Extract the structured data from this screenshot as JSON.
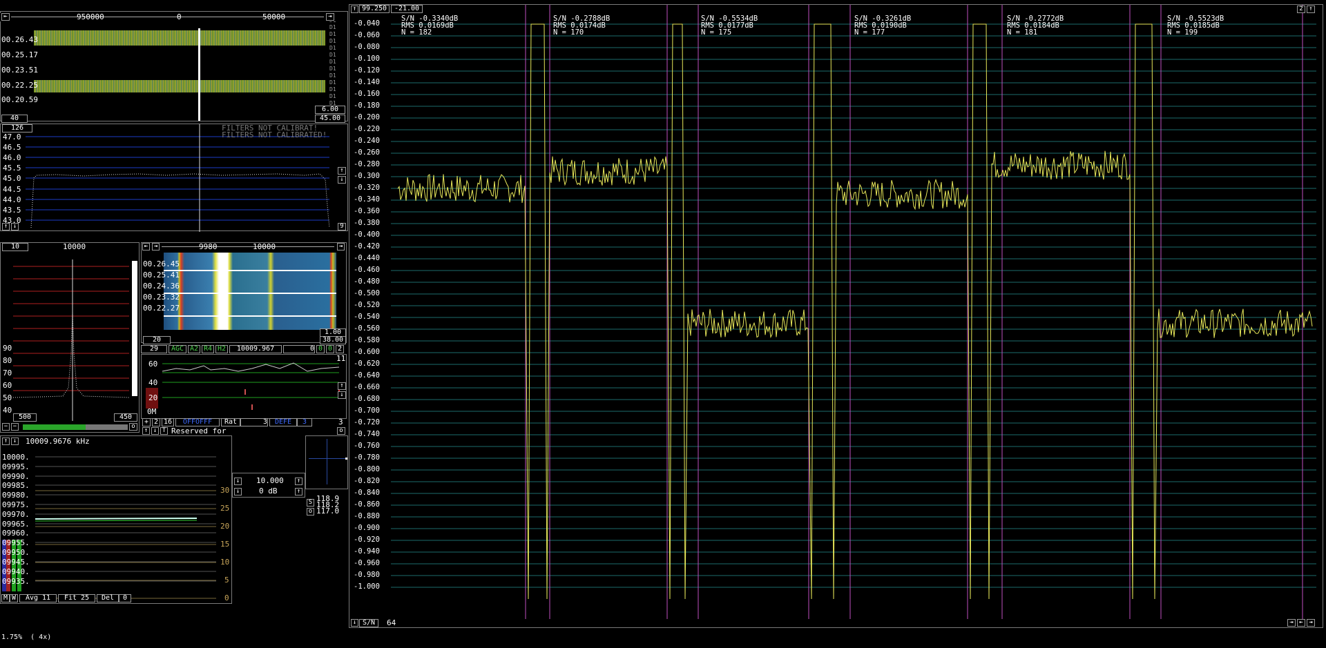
{
  "waterfall": {
    "freq_ticks": [
      "950000",
      "0",
      "50000"
    ],
    "times": [
      "00.26.43",
      "00.25.17",
      "00.23.51",
      "00.22.25",
      "00.20.59"
    ],
    "right_label": "D1",
    "left_box": "40",
    "right_box_top": "6.00",
    "right_box_bottom": "45.00"
  },
  "spectrum": {
    "top_box": "126",
    "warning_1": "FILTERS NOT CALIBRAT!",
    "warning_2": "FILTERS NOT CALIBRATED!",
    "y_labels": [
      "47.0",
      "46.5",
      "46.0",
      "45.5",
      "45.0",
      "44.5",
      "44.0",
      "43.5",
      "43.0"
    ],
    "right_btn": "9"
  },
  "baseband": {
    "left_box": "10",
    "freq_tick": "10000",
    "y_labels": [
      "90",
      "80",
      "70",
      "60",
      "50",
      "40"
    ],
    "left_bottom": "500",
    "right_bottom": "450",
    "o_btn": "o"
  },
  "highres": {
    "freq_ticks": [
      "9980",
      "10000"
    ],
    "times": [
      "00.26.45",
      "00.25.41",
      "00.24.36",
      "00.23.32",
      "00.22.27"
    ],
    "box_top": "1.00",
    "box_bottom": "38.00",
    "left_box": "20",
    "controls_row": {
      "num": "29",
      "agc": "AGC",
      "a2": "A2",
      "r4": "R4",
      "h2": "H2",
      "freq": "10009.967",
      "zero": "0",
      "b1": "0",
      "b2": "0",
      "b3": "2"
    },
    "audio_y": [
      "60",
      "40",
      "20",
      "0M"
    ],
    "audio_right": "11",
    "bottom_row": {
      "plus": "+",
      "two": "2",
      "sixteen": "16",
      "offoff": "OFFOFFF",
      "rat": "Rat",
      "rat_val": "3",
      "defe": "DEFE",
      "defe_val": "3",
      "three": "3"
    },
    "reserved": "Reserved for"
  },
  "freqlog": {
    "title": "10009.9676 kHz",
    "y_labels": [
      "10000.",
      "09995.",
      "09990.",
      "09985.",
      "09980.",
      "09975.",
      "09970.",
      "09965.",
      "09960.",
      "09955.",
      "09950.",
      "09945.",
      "09940.",
      "09935."
    ],
    "right_labels": [
      "30",
      "25",
      "20",
      "15",
      "10",
      "5",
      "0"
    ],
    "bottom": {
      "m": "M",
      "w": "W",
      "avg": "Avg 11",
      "fit": "Fit 25",
      "del": "Del",
      "del_val": "0"
    }
  },
  "step": {
    "freq": "10.000",
    "db": "0 dB",
    "s": "S",
    "values": [
      "118.9",
      "118.2",
      "117.0"
    ]
  },
  "status": {
    "zoom": "1.75%  ( 4x)"
  },
  "phase": {
    "top_left_1": "99.250",
    "top_left_2": "-21.00",
    "top_right": "2",
    "y_labels": [
      "-0.040",
      "-0.060",
      "-0.080",
      "-0.100",
      "-0.120",
      "-0.140",
      "-0.160",
      "-0.180",
      "-0.200",
      "-0.220",
      "-0.240",
      "-0.260",
      "-0.280",
      "-0.300",
      "-0.320",
      "-0.340",
      "-0.360",
      "-0.380",
      "-0.400",
      "-0.420",
      "-0.440",
      "-0.460",
      "-0.480",
      "-0.500",
      "-0.520",
      "-0.540",
      "-0.560",
      "-0.580",
      "-0.600",
      "-0.620",
      "-0.640",
      "-0.660",
      "-0.680",
      "-0.700",
      "-0.720",
      "-0.740",
      "-0.760",
      "-0.780",
      "-0.800",
      "-0.820",
      "-0.840",
      "-0.860",
      "-0.880",
      "-0.900",
      "-0.920",
      "-0.940",
      "-0.960",
      "-0.980",
      "-1.000"
    ],
    "stats": [
      {
        "sn": "S/N -0.3340dB",
        "rms": "RMS 0.0169dB",
        "n": "N = 182"
      },
      {
        "sn": "S/N -0.2788dB",
        "rms": "RMS 0.0174dB",
        "n": "N = 170"
      },
      {
        "sn": "S/N -0.5534dB",
        "rms": "RMS 0.0177dB",
        "n": "N = 175"
      },
      {
        "sn": "S/N -0.3261dB",
        "rms": "RMS 0.0190dB",
        "n": "N = 177"
      },
      {
        "sn": "S/N -0.2772dB",
        "rms": "RMS 0.0184dB",
        "n": "N = 181"
      },
      {
        "sn": "S/N -0.5523dB",
        "rms": "RMS 0.0185dB",
        "n": "N = 199"
      }
    ],
    "bottom_sn": "S/N",
    "bottom_val": "64",
    "series_levels": [
      -0.32,
      -0.29,
      -0.55,
      -0.33,
      -0.28,
      -0.55
    ],
    "colors": {
      "trace": "#e8e85a",
      "marker": "#c050c0",
      "grid": "#1d6b6b"
    }
  }
}
